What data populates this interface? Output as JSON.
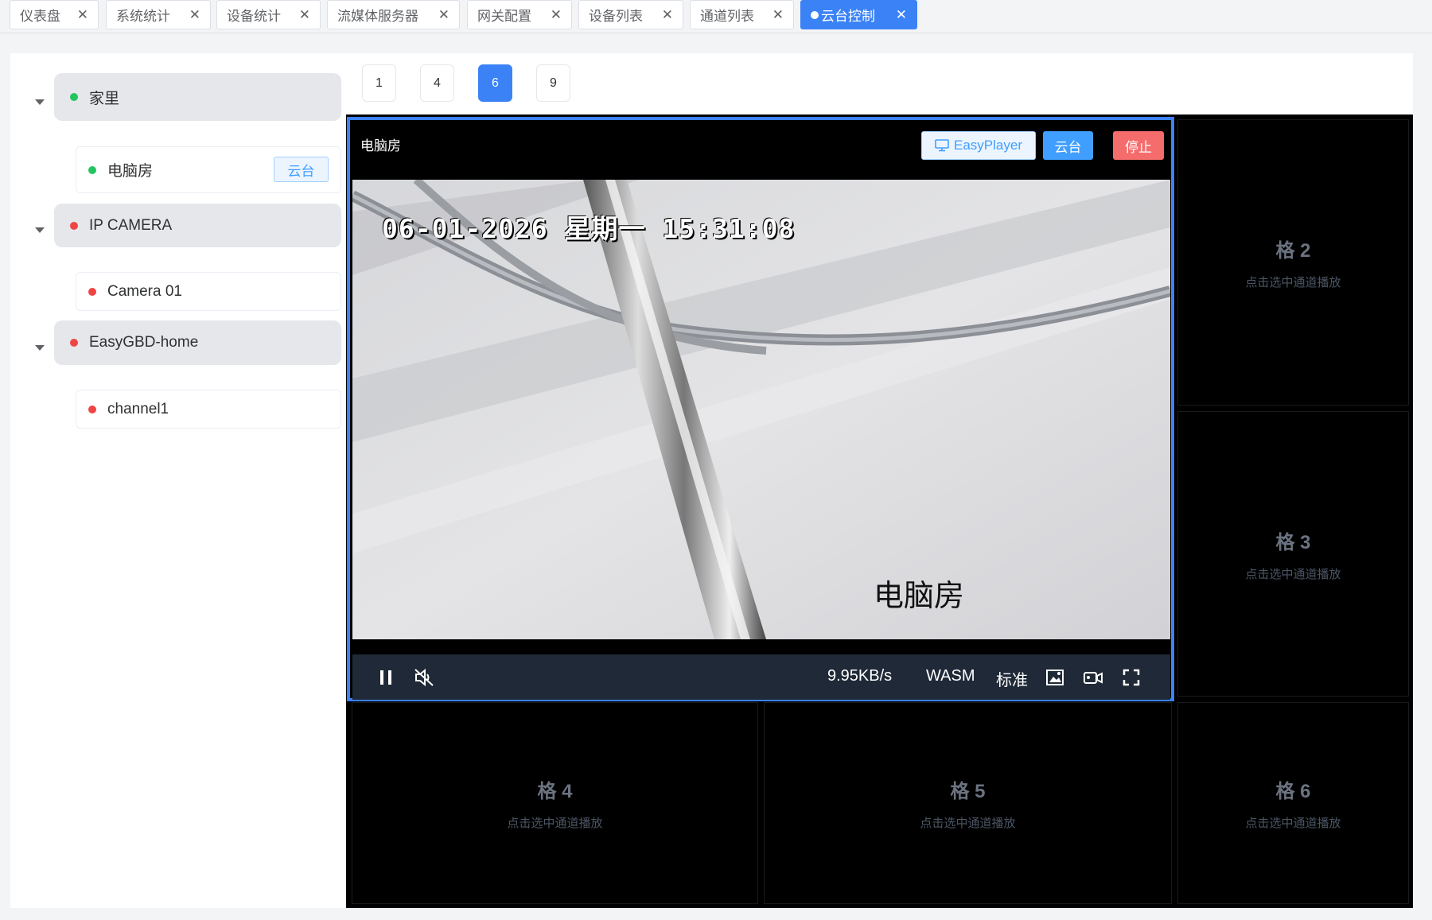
{
  "tabs": [
    {
      "label": "仪表盘",
      "active": false
    },
    {
      "label": "系统统计",
      "active": false
    },
    {
      "label": "设备统计",
      "active": false
    },
    {
      "label": "流媒体服务器",
      "active": false
    },
    {
      "label": "网关配置",
      "active": false
    },
    {
      "label": "设备列表",
      "active": false
    },
    {
      "label": "通道列表",
      "active": false
    },
    {
      "label": "云台控制",
      "active": true
    }
  ],
  "tree": [
    {
      "label": "家里",
      "status": "online",
      "children": [
        {
          "label": "电脑房",
          "status": "online",
          "tag": "云台"
        }
      ]
    },
    {
      "label": "IP CAMERA",
      "status": "offline",
      "children": [
        {
          "label": "Camera 01",
          "status": "offline"
        }
      ]
    },
    {
      "label": "EasyGBD-home",
      "status": "offline",
      "children": [
        {
          "label": "channel1",
          "status": "offline"
        }
      ]
    }
  ],
  "layouts": {
    "options": [
      "1",
      "4",
      "6",
      "9"
    ],
    "selected": "6"
  },
  "player": {
    "title": "电脑房",
    "easyplayer_label": "EasyPlayer",
    "ptz_label": "云台",
    "stop_label": "停止",
    "osd_time": "06-01-2026 星期一 15:31:08",
    "osd_name": "电脑房",
    "bitrate": "9.95KB/s",
    "decoder": "WASM",
    "quality": "标准"
  },
  "cells": [
    {
      "name": "格 2",
      "hint": "点击选中通道播放"
    },
    {
      "name": "格 3",
      "hint": "点击选中通道播放"
    },
    {
      "name": "格 4",
      "hint": "点击选中通道播放"
    },
    {
      "name": "格 5",
      "hint": "点击选中通道播放"
    },
    {
      "name": "格 6",
      "hint": "点击选中通道播放"
    }
  ],
  "colors": {
    "accent": "#3b82f6",
    "online": "#22c55e",
    "offline": "#ef4444",
    "stop": "#f56c6c"
  },
  "icons": [
    "close-icon",
    "monitor-icon",
    "pause-icon",
    "mute-icon",
    "screenshot-icon",
    "record-icon",
    "fullscreen-icon",
    "caret-down-icon"
  ]
}
